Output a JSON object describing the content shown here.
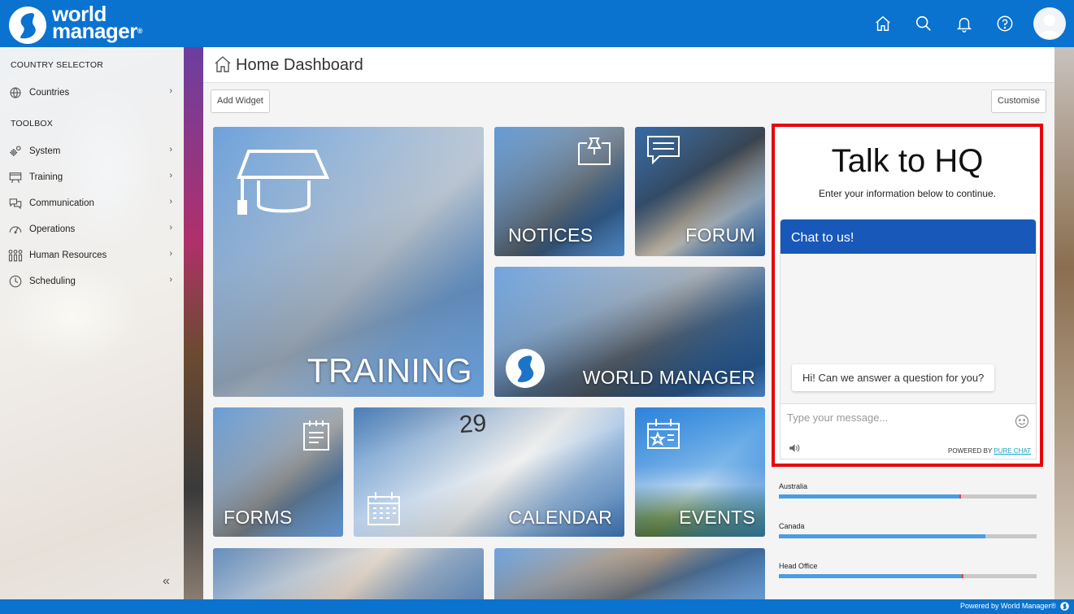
{
  "header": {
    "logo_line1": "world",
    "logo_line2": "manager",
    "logo_reg": "®",
    "icons": [
      "home-icon",
      "search-icon",
      "bell-icon",
      "help-icon",
      "avatar"
    ]
  },
  "sidebar": {
    "section1": "COUNTRY SELECTOR",
    "countries": "Countries",
    "section2": "TOOLBOX",
    "items": [
      {
        "label": "System",
        "icon": "gears-icon"
      },
      {
        "label": "Training",
        "icon": "presentation-board-icon"
      },
      {
        "label": "Communication",
        "icon": "chat-bubbles-icon"
      },
      {
        "label": "Operations",
        "icon": "gauge-icon"
      },
      {
        "label": "Human Resources",
        "icon": "people-icon"
      },
      {
        "label": "Scheduling",
        "icon": "clock-icon"
      }
    ],
    "collapse": "«"
  },
  "page": {
    "title": "Home Dashboard",
    "add_widget": "Add Widget",
    "customise": "Customise"
  },
  "tiles": {
    "training": "TRAINING",
    "notices": "NOTICES",
    "forum": "FORUM",
    "world_manager": "WORLD MANAGER",
    "forms": "FORMS",
    "calendar": "CALENDAR",
    "calendar_day": "29",
    "events": "EVENTS"
  },
  "chat": {
    "title": "Talk to HQ",
    "subtitle": "Enter your information below to continue.",
    "header": "Chat to us!",
    "greeting": "Hi! Can we answer a question for you?",
    "placeholder": "Type your message...",
    "powered_by": "POWERED BY ",
    "powered_link": "PURE CHAT"
  },
  "progress": [
    {
      "name": "Australia",
      "fill": 0.7,
      "marker": 0.7
    },
    {
      "name": "Canada",
      "fill": 0.8,
      "marker": null
    },
    {
      "name": "Head Office",
      "fill": 0.71,
      "marker": 0.71
    }
  ],
  "footer": {
    "text": "Powered by World Manager®"
  },
  "colors": {
    "brand_blue": "#0a72cf",
    "chat_header": "#1758b8",
    "highlight_red": "#e8000b",
    "progress_blue": "#4a9de0"
  }
}
